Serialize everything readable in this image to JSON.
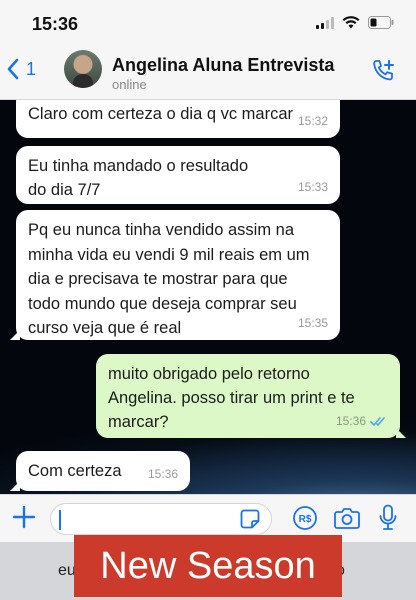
{
  "status_bar": {
    "time": "15:36"
  },
  "header": {
    "back_count": "1",
    "contact_name": "Angelina Aluna Entrevista",
    "contact_status": "online"
  },
  "messages": [
    {
      "direction": "in",
      "text": "Claro com certeza o dia q vc marcar",
      "time": "15:32"
    },
    {
      "direction": "in",
      "text": "Eu tinha mandado o resultado do dia 7/7",
      "time": "15:33"
    },
    {
      "direction": "in",
      "text": "Pq eu nunca tinha vendido assim na minha vida eu vendi 9 mil reais em um dia e precisava te mostrar para que todo mundo que deseja comprar seu curso veja que é real",
      "time": "15:35"
    },
    {
      "direction": "out",
      "text": "muito obrigado pelo retorno Angelina. posso tirar um print e te marcar?",
      "time": "15:36",
      "read": true
    },
    {
      "direction": "in",
      "text": "Com certeza",
      "time": "15:36"
    }
  ],
  "input": {
    "value": ""
  },
  "keyboard": {
    "suggestion_left": "eu",
    "suggestion_right": "o"
  },
  "overlay": {
    "banner_text": "New Season"
  },
  "colors": {
    "accent": "#1a73e8",
    "incoming": "#ffffff",
    "outgoing": "#dcf8c6",
    "banner": "#cc3a2c"
  },
  "icons": [
    "back-chevron-icon",
    "call-add-icon",
    "plus-icon",
    "sticker-icon",
    "pay-icon",
    "camera-icon",
    "mic-icon",
    "read-ticks-icon",
    "signal-icon",
    "wifi-icon",
    "battery-icon"
  ]
}
